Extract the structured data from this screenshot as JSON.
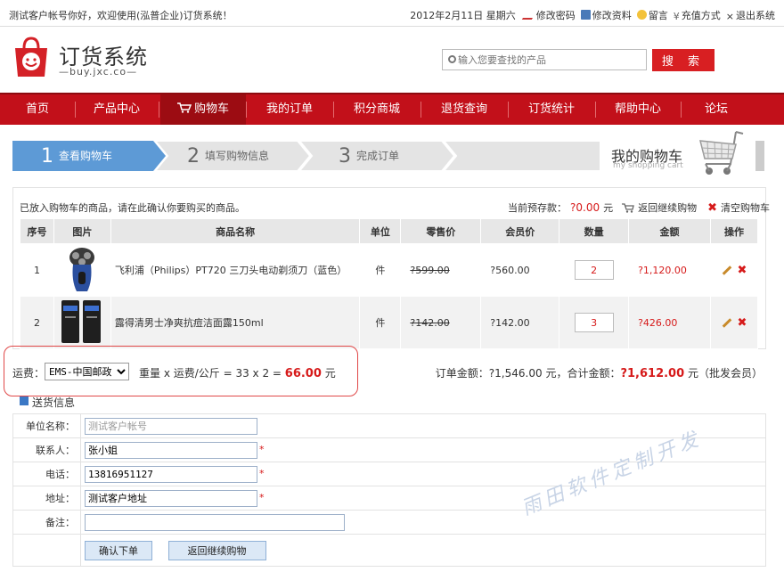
{
  "topbar": {
    "welcome": "测试客户帐号你好，欢迎使用(泓普企业)订货系统！",
    "date": "2012年2月11日 星期六",
    "links": [
      {
        "label": "修改密码",
        "icon": "pencil-icon"
      },
      {
        "label": "修改资料",
        "icon": "card-icon"
      },
      {
        "label": "留言",
        "icon": "message-icon"
      },
      {
        "label": "充值方式",
        "icon": "yen-icon"
      },
      {
        "label": "退出系统",
        "icon": "close-icon"
      }
    ]
  },
  "logo": {
    "name": "订货系统",
    "domain": "buy.jxc.co"
  },
  "search": {
    "placeholder": "输入您要查找的产品",
    "button": "搜 索"
  },
  "nav": [
    "首页",
    "产品中心",
    "购物车",
    "我的订单",
    "积分商城",
    "退货查询",
    "订货统计",
    "帮助中心",
    "论坛"
  ],
  "steps": [
    {
      "num": "1",
      "label": "查看购物车"
    },
    {
      "num": "2",
      "label": "填写购物信息"
    },
    {
      "num": "3",
      "label": "完成订单"
    }
  ],
  "cart_header": {
    "title": "我的购物车",
    "subtitle": "my shopping cart"
  },
  "cart": {
    "note": "已放入购物车的商品，请在此确认你要购买的商品。",
    "deposit_label": "当前预存款：",
    "deposit_value": "?0.00",
    "deposit_unit": "元",
    "continue": "返回继续购物",
    "clear": "清空购物车",
    "columns": [
      "序号",
      "图片",
      "商品名称",
      "单位",
      "零售价",
      "会员价",
      "数量",
      "金额",
      "操作"
    ],
    "rows": [
      {
        "no": "1",
        "name": "飞利浦（Philips）PT720 三刀头电动剃须刀（蓝色）",
        "unit": "件",
        "retail": "?599.00",
        "member": "?560.00",
        "qty": "2",
        "amount": "?1,120.00"
      },
      {
        "no": "2",
        "name": "露得清男士净爽抗痘洁面露150ml",
        "unit": "件",
        "retail": "?142.00",
        "member": "?142.00",
        "qty": "3",
        "amount": "?426.00"
      }
    ]
  },
  "shipping": {
    "label": "运费：",
    "method": "EMS-中国邮政",
    "formula": "重量 x 运费/公斤 =  33  x 2  = ",
    "cost": "66.00",
    "unit": "元"
  },
  "order_summary": {
    "order_label": "订单金额：",
    "order_amount": "?1,546.00",
    "mid": "元，合计金额：",
    "total": "?1,612.00",
    "suffix": "元（批发会员）"
  },
  "delivery": {
    "title": "送货信息",
    "fields": [
      {
        "label": "单位名称：",
        "value": "测试客户帐号",
        "required": false
      },
      {
        "label": "联系人：",
        "value": "张小姐",
        "required": true
      },
      {
        "label": "电话：",
        "value": "13816951127",
        "required": true
      },
      {
        "label": "地址：",
        "value": "测试客户地址",
        "required": true
      },
      {
        "label": "备注：",
        "value": "",
        "required": false
      }
    ],
    "confirm": "确认下单",
    "back": "返回继续购物"
  },
  "watermark": "雨田软件定制开发",
  "colors": {
    "brand_red": "#c2101a",
    "price_red": "#d61a1a",
    "step_active": "#5d9ad6"
  }
}
